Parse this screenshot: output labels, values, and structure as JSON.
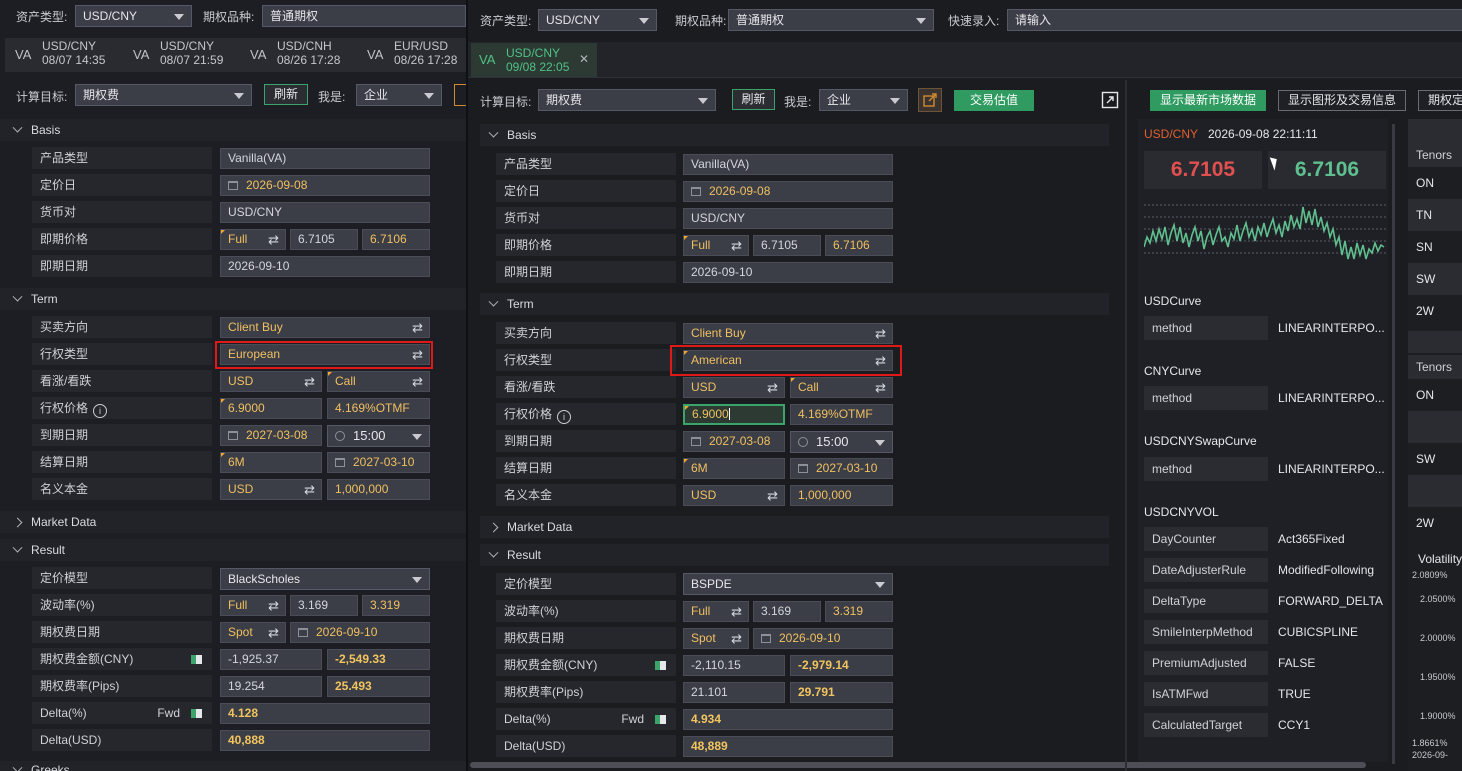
{
  "left": {
    "asset_label": "资产类型:",
    "asset_value": "USD/CNY",
    "option_label": "期权品种:",
    "option_value": "普通期权",
    "tabs": [
      {
        "type": "VA",
        "pair": "USD/CNY",
        "time": "08/07 14:35"
      },
      {
        "type": "VA",
        "pair": "USD/CNY",
        "time": "08/07 21:59"
      },
      {
        "type": "VA",
        "pair": "USD/CNH",
        "time": "08/26 17:28"
      },
      {
        "type": "VA",
        "pair": "EUR/USD",
        "time": "08/26 17:28"
      }
    ],
    "calc_label": "计算目标:",
    "calc_value": "期权费",
    "refresh": "刷新",
    "iam_label": "我是:",
    "iam_value": "企业",
    "sections": {
      "basis": "Basis",
      "term": "Term",
      "market": "Market Data",
      "result": "Result",
      "next": "Greeks"
    },
    "basis": {
      "product_label": "产品类型",
      "product": "Vanilla(VA)",
      "pricing_date_label": "定价日",
      "pricing_date": "2026-09-08",
      "pair_label": "货币对",
      "pair": "USD/CNY",
      "spot_label": "即期价格",
      "spot_mode": "Full",
      "spot_bid": "6.7105",
      "spot_ask": "6.7106",
      "spot_date_label": "即期日期",
      "spot_date": "2026-09-10"
    },
    "term": {
      "direction_label": "买卖方向",
      "direction": "Client Buy",
      "exercise_label": "行权类型",
      "exercise": "European",
      "callput_label": "看涨/看跌",
      "ccy": "USD",
      "callput": "Call",
      "strike_label": "行权价格",
      "strike": "6.9000",
      "moneyness": "4.169%OTMF",
      "expiry_label": "到期日期",
      "expiry": "2027-03-08",
      "expiry_time": "15:00",
      "settle_label": "结算日期",
      "tenor": "6M",
      "settle": "2027-03-10",
      "notional_label": "名义本金",
      "notional_ccy": "USD",
      "notional": "1,000,000"
    },
    "result": {
      "model_label": "定价模型",
      "model": "BlackScholes",
      "vol_label": "波动率(%)",
      "vol_mode": "Full",
      "vol_bid": "3.169",
      "vol_ask": "3.319",
      "prem_date_label": "期权费日期",
      "prem_date_mode": "Spot",
      "prem_date": "2026-09-10",
      "prem_amt_label": "期权费金额(CNY)",
      "prem_amt_1": "-1,925.37",
      "prem_amt_2": "-2,549.33",
      "prem_pips_label": "期权费率(Pips)",
      "prem_pips_1": "19.254",
      "prem_pips_2": "25.493",
      "delta_pct_label": "Delta(%)",
      "fwd": "Fwd",
      "delta_pct": "4.128",
      "delta_usd_label": "Delta(USD)",
      "delta_usd": "40,888"
    }
  },
  "right": {
    "asset_label": "资产类型:",
    "asset_value": "USD/CNY",
    "option_label": "期权品种:",
    "option_value": "普通期权",
    "quick_label": "快速录入:",
    "quick_placeholder": "请输入",
    "tab": {
      "type": "VA",
      "pair": "USD/CNY",
      "time": "09/08 22:05"
    },
    "calc_label": "计算目标:",
    "calc_value": "期权费",
    "refresh": "刷新",
    "iam_label": "我是:",
    "iam_value": "企业",
    "trade_value_btn": "交易估值",
    "sections": {
      "basis": "Basis",
      "term": "Term",
      "market": "Market Data",
      "result": "Result"
    },
    "basis": {
      "product_label": "产品类型",
      "product": "Vanilla(VA)",
      "pricing_date_label": "定价日",
      "pricing_date": "2026-09-08",
      "pair_label": "货币对",
      "pair": "USD/CNY",
      "spot_label": "即期价格",
      "spot_mode": "Full",
      "spot_bid": "6.7105",
      "spot_ask": "6.7106",
      "spot_date_label": "即期日期",
      "spot_date": "2026-09-10"
    },
    "term": {
      "direction_label": "买卖方向",
      "direction": "Client Buy",
      "exercise_label": "行权类型",
      "exercise": "American",
      "callput_label": "看涨/看跌",
      "ccy": "USD",
      "callput": "Call",
      "strike_label": "行权价格",
      "strike": "6.9000",
      "moneyness": "4.169%OTMF",
      "expiry_label": "到期日期",
      "expiry": "2027-03-08",
      "expiry_time": "15:00",
      "settle_label": "结算日期",
      "tenor": "6M",
      "settle": "2027-03-10",
      "notional_label": "名义本金",
      "notional_ccy": "USD",
      "notional": "1,000,000"
    },
    "result": {
      "model_label": "定价模型",
      "model": "BSPDE",
      "vol_label": "波动率(%)",
      "vol_mode": "Full",
      "vol_bid": "3.169",
      "vol_ask": "3.319",
      "prem_date_label": "期权费日期",
      "prem_date_mode": "Spot",
      "prem_date": "2026-09-10",
      "prem_amt_label": "期权费金额(CNY)",
      "prem_amt_1": "-2,110.15",
      "prem_amt_2": "-2,979.14",
      "prem_pips_label": "期权费率(Pips)",
      "prem_pips_1": "21.101",
      "prem_pips_2": "29.791",
      "delta_pct_label": "Delta(%)",
      "fwd": "Fwd",
      "delta_pct": "4.934",
      "delta_usd_label": "Delta(USD)",
      "delta_usd": "48,889"
    }
  },
  "market": {
    "btn_latest": "显示最新市场数据",
    "btn_graph": "显示图形及交易信息",
    "btn_more": "期权定",
    "pair": "USD/CNY",
    "timestamp": "2026-09-08 22:11:11",
    "bid": "6.7105",
    "ask": "6.7106",
    "curves": [
      {
        "title": "USDCurve",
        "key": "method",
        "value": "LINEARINTERPO..."
      },
      {
        "title": "CNYCurve",
        "key": "method",
        "value": "LINEARINTERPO..."
      },
      {
        "title": "USDCNYSwapCurve",
        "key": "method",
        "value": "LINEARINTERPO..."
      }
    ],
    "vol_title": "USDCNYVOL",
    "vol_params": [
      {
        "key": "DayCounter",
        "value": "Act365Fixed"
      },
      {
        "key": "DateAdjusterRule",
        "value": "ModifiedFollowing"
      },
      {
        "key": "DeltaType",
        "value": "FORWARD_DELTA"
      },
      {
        "key": "SmileInterpMethod",
        "value": "CUBICSPLINE"
      },
      {
        "key": "PremiumAdjusted",
        "value": "FALSE"
      },
      {
        "key": "IsATMFwd",
        "value": "TRUE"
      },
      {
        "key": "CalculatedTarget",
        "value": "CCY1"
      }
    ]
  },
  "tenors": {
    "header1": "Tenors",
    "list1": [
      "ON",
      "TN",
      "SN",
      "SW",
      "2W"
    ],
    "header2": "Tenors",
    "list2": [
      "ON",
      "",
      "SW",
      "",
      "2W"
    ],
    "vol_title": "Volatility",
    "vol_ticks": [
      "2.0809%",
      "2.0500%",
      "2.0000%",
      "1.9500%",
      "1.9000%",
      "1.8661%"
    ],
    "date_tick": "2026-09-"
  },
  "colors": {
    "accent_green": "#2f9b60",
    "bid_red": "#e05050",
    "ask_green": "#5fbf8e",
    "highlight_red": "#e01818",
    "value_yellow": "#f2c55e"
  }
}
